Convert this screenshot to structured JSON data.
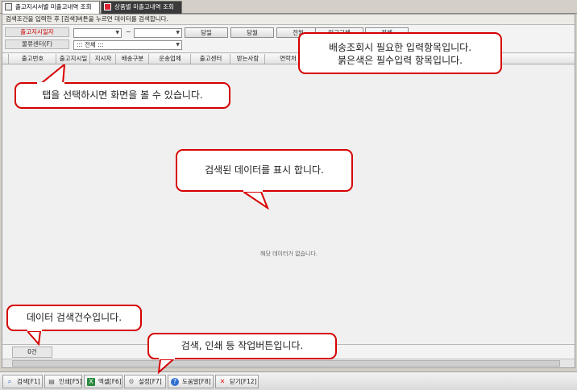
{
  "tabs": [
    {
      "label": "출고지시서별 미출고내역 조회",
      "active": true
    },
    {
      "label": "상품별 미출고내역 조회",
      "active": false
    }
  ],
  "infobar": {
    "text": "검색조건을 입력한 후 [검색]버튼을 누르면 데이터를 검색합니다."
  },
  "search": {
    "date_label": "출고지시일자",
    "date_from": "",
    "date_to": "",
    "tilde": "~",
    "center_label": "물류센터(F)",
    "center_value": "::: 전체 :::",
    "quick_buttons": [
      "당일",
      "당월",
      "전월",
      "입고교체",
      "전체"
    ]
  },
  "grid": {
    "columns": [
      "출고번호",
      "출고지시일",
      "지시자",
      "배송구분",
      "운송업체",
      "출고센터",
      "받는사람",
      "연락처"
    ],
    "empty_text": "해당 데이터가 없습니다."
  },
  "count": {
    "text": "0건"
  },
  "toolbar": {
    "search": "검색[F1]",
    "print": "인쇄[F5]",
    "excel": "엑셀[F6]",
    "settings": "설정[F7]",
    "help": "도움말[F8]",
    "close": "닫기[F12]"
  },
  "callouts": {
    "input": [
      "배송조회시 필요한 입력항목입니다.",
      "붉은색은 필수입력 항목입니다."
    ],
    "tab": "탭을 선택하시면 화면을 볼 수 있습니다.",
    "data": "검색된 데이터를 표시 합니다.",
    "count": "데이터 검색건수입니다.",
    "buttons": "검색, 인쇄 등 작업버튼입니다."
  },
  "colors": {
    "callout_border": "#d60000",
    "required_label": "#c00000"
  }
}
